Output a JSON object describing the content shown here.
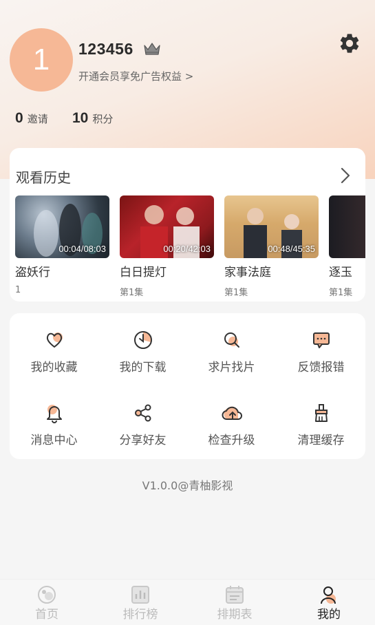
{
  "profile": {
    "avatar_text": "1",
    "username": "123456",
    "vip_text": "开通会员享免广告权益 >"
  },
  "stats": [
    {
      "value": "0",
      "label": "邀请"
    },
    {
      "value": "10",
      "label": "积分"
    }
  ],
  "history": {
    "title": "观看历史",
    "items": [
      {
        "title": "盗妖行",
        "time": "00:04/08:03",
        "episode": "1"
      },
      {
        "title": "白日提灯",
        "time": "00:20/42:03",
        "episode": "第1集"
      },
      {
        "title": "家事法庭",
        "time": "00:48/45:35",
        "episode": "第1集"
      },
      {
        "title": "逐玉",
        "time": "",
        "episode": "第1集"
      }
    ]
  },
  "menu": {
    "items": [
      {
        "label": "我的收藏",
        "icon": "heart-icon"
      },
      {
        "label": "我的下载",
        "icon": "download-icon"
      },
      {
        "label": "求片找片",
        "icon": "search-icon"
      },
      {
        "label": "反馈报错",
        "icon": "feedback-icon"
      },
      {
        "label": "消息中心",
        "icon": "bell-icon"
      },
      {
        "label": "分享好友",
        "icon": "share-icon"
      },
      {
        "label": "检查升级",
        "icon": "upgrade-icon"
      },
      {
        "label": "清理缓存",
        "icon": "clean-icon"
      }
    ]
  },
  "version": "V1.0.0@青柚影视",
  "tabs": [
    {
      "label": "首页",
      "icon": "home-icon",
      "active": false
    },
    {
      "label": "排行榜",
      "icon": "ranking-icon",
      "active": false
    },
    {
      "label": "排期表",
      "icon": "schedule-icon",
      "active": false
    },
    {
      "label": "我的",
      "icon": "profile-icon",
      "active": true
    }
  ],
  "colors": {
    "accent": "#f6b896",
    "accent_dark": "#333333"
  }
}
